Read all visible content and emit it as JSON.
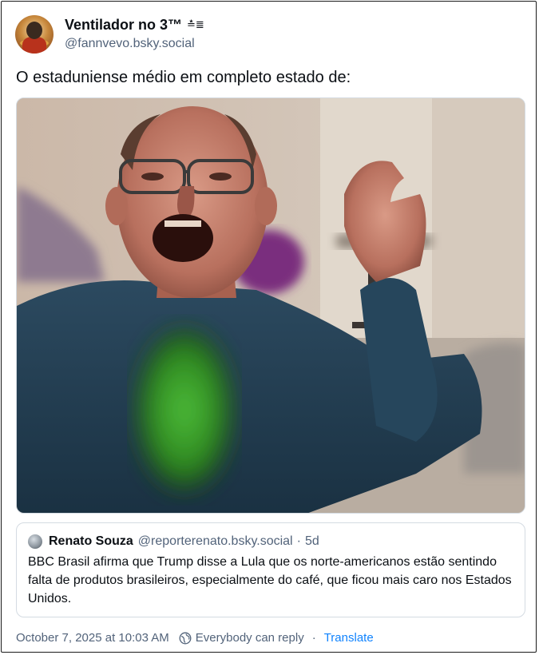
{
  "post": {
    "author": {
      "display_name": "Ventilador no 3™",
      "name_glyph": "≛≣",
      "handle": "@fannvevo.bsky.social"
    },
    "text": "O estaduniense médio em completo estado de:",
    "quote": {
      "author_name": "Renato Souza",
      "author_handle": "@reporterenato.bsky.social",
      "separator": "·",
      "age": "5d",
      "text": "BBC Brasil afirma que Trump disse a Lula que os norte-americanos estão sentindo falta de produtos brasileiros, especialmente do café, que ficou mais caro nos Estados Unidos."
    },
    "footer": {
      "timestamp": "October 7, 2025 at 10:03 AM",
      "reply_setting": "Everybody can reply",
      "separator": "·",
      "translate_label": "Translate"
    }
  },
  "colors": {
    "text_primary": "#0b0f14",
    "text_secondary": "#52637a",
    "link": "#1083fe",
    "border": "#d4dbe2"
  },
  "icons": {
    "reply_setting_icon": "globe-icon"
  }
}
